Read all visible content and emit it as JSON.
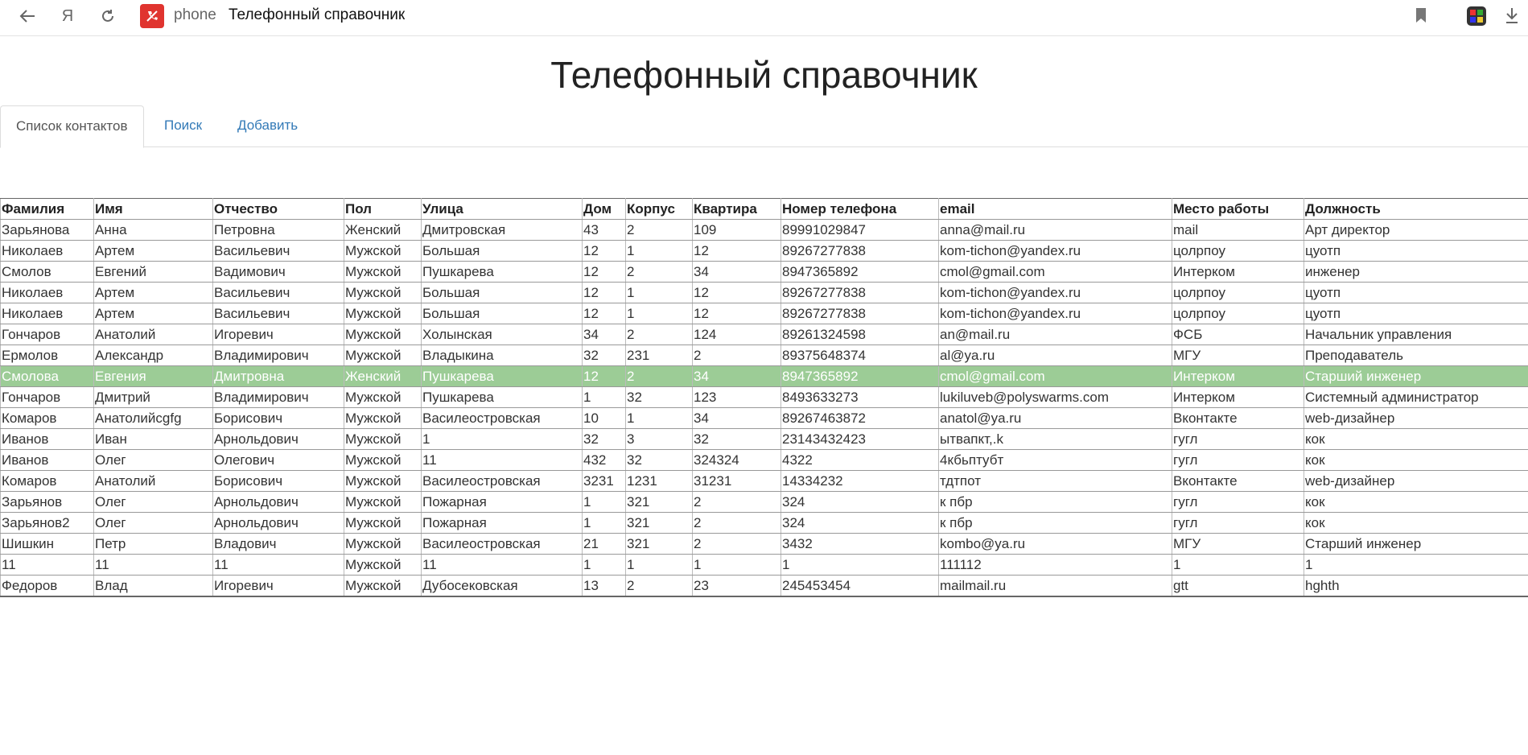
{
  "browser": {
    "host": "phone",
    "tab_title": "Телефонный справочник",
    "yandex_label": "Я"
  },
  "page": {
    "title": "Телефонный справочник"
  },
  "tabs": [
    {
      "label": "Список контактов",
      "active": true
    },
    {
      "label": "Поиск",
      "active": false
    },
    {
      "label": "Добавить",
      "active": false
    }
  ],
  "table": {
    "headers": [
      "Фамилия",
      "Имя",
      "Отчество",
      "Пол",
      "Улица",
      "Дом",
      "Корпус",
      "Квартира",
      "Номер телефона",
      "email",
      "Место работы",
      "Должность"
    ],
    "rows": [
      [
        "Зарьянова",
        "Анна",
        "Петровна",
        "Женский",
        "Дмитровская",
        "43",
        "2",
        "109",
        "89991029847",
        "anna@mail.ru",
        "mail",
        "Арт директор"
      ],
      [
        "Николаев",
        "Артем",
        "Васильевич",
        "Мужской",
        "Большая",
        "12",
        "1",
        "12",
        "89267277838",
        "kom-tichon@yandex.ru",
        "цолрпоу",
        "цуотп"
      ],
      [
        "Смолов",
        "Евгений",
        "Вадимович",
        "Мужской",
        "Пушкарева",
        "12",
        "2",
        "34",
        "8947365892",
        "cmol@gmail.com",
        "Интерком",
        "инженер"
      ],
      [
        "Николаев",
        "Артем",
        "Васильевич",
        "Мужской",
        "Большая",
        "12",
        "1",
        "12",
        "89267277838",
        "kom-tichon@yandex.ru",
        "цолрпоу",
        "цуотп"
      ],
      [
        "Николаев",
        "Артем",
        "Васильевич",
        "Мужской",
        "Большая",
        "12",
        "1",
        "12",
        "89267277838",
        "kom-tichon@yandex.ru",
        "цолрпоу",
        "цуотп"
      ],
      [
        "Гончаров",
        "Анатолий",
        "Игоревич",
        "Мужской",
        "Холынская",
        "34",
        "2",
        "124",
        "89261324598",
        "an@mail.ru",
        "ФСБ",
        "Начальник управления"
      ],
      [
        "Ермолов",
        "Александр",
        "Владимирович",
        "Мужской",
        "Владыкина",
        "32",
        "231",
        "2",
        "89375648374",
        "al@ya.ru",
        "МГУ",
        "Преподаватель"
      ],
      [
        "Смолова",
        "Евгения",
        "Дмитровна",
        "Женский",
        "Пушкарева",
        "12",
        "2",
        "34",
        "8947365892",
        "cmol@gmail.com",
        "Интерком",
        "Старший инженер"
      ],
      [
        "Гончаров",
        "Дмитрий",
        "Владимирович",
        "Мужской",
        "Пушкарева",
        "1",
        "32",
        "123",
        "8493633273",
        "lukiluveb@polyswarms.com",
        "Интерком",
        "Системный администратор"
      ],
      [
        "Комаров",
        "Анатолийсgfg",
        "Борисович",
        "Мужской",
        "Василеостровская",
        "10",
        "1",
        "34",
        "89267463872",
        "anatol@ya.ru",
        "Вконтакте",
        "web-дизайнер"
      ],
      [
        "Иванов",
        "Иван",
        "Арнольдович",
        "Мужской",
        "1",
        "32",
        "3",
        "32",
        "23143432423",
        "ытвапкт,.k",
        "гугл",
        "кок"
      ],
      [
        "Иванов",
        "Олег",
        "Олегович",
        "Мужской",
        "11",
        "432",
        "32",
        "324324",
        "4322",
        "4кбьптубт",
        "гугл",
        "кок"
      ],
      [
        "Комаров",
        "Анатолий",
        "Борисович",
        "Мужской",
        "Василеостровская",
        "3231",
        "1231",
        "31231",
        "14334232",
        "тдтпот",
        "Вконтакте",
        "web-дизайнер"
      ],
      [
        "Зарьянов",
        "Олег",
        "Арнольдович",
        "Мужской",
        "Пожарная",
        "1",
        "321",
        "2",
        "324",
        "к пбр",
        "гугл",
        "кок"
      ],
      [
        "Зарьянов2",
        "Олег",
        "Арнольдович",
        "Мужской",
        "Пожарная",
        "1",
        "321",
        "2",
        "324",
        "к пбр",
        "гугл",
        "кок"
      ],
      [
        "Шишкин",
        "Петр",
        "Владович",
        "Мужской",
        "Василеостровская",
        "21",
        "321",
        "2",
        "3432",
        "kombo@ya.ru",
        "МГУ",
        "Старший инженер"
      ],
      [
        "11",
        "11",
        "11",
        "Мужской",
        "11",
        "1",
        "1",
        "1",
        "1",
        "111112",
        "1",
        "1"
      ],
      [
        "Федоров",
        "Влад",
        "Игоревич",
        "Мужской",
        "Дубосековская",
        "13",
        "2",
        "23",
        "245453454",
        "mailmail.ru",
        "gtt",
        "hghth"
      ]
    ],
    "highlighted_row": 7,
    "highlight_color": "#9ccc96"
  }
}
